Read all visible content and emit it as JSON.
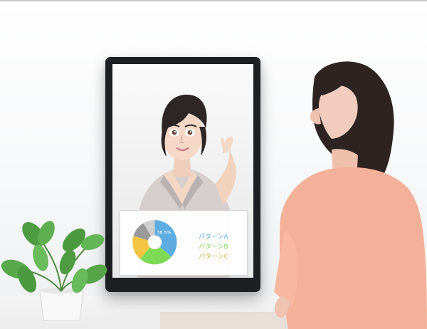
{
  "chart_data": {
    "type": "pie",
    "categories": [
      "パターンA",
      "パターンB",
      "パターンC",
      "",
      ""
    ],
    "values": [
      36.5,
      25,
      18,
      12,
      8.5
    ],
    "labels": [
      "36.5%"
    ],
    "legend": [
      {
        "label": "パターンA",
        "color": "#5dade2"
      },
      {
        "label": "パターンB",
        "color": "#7ed957"
      },
      {
        "label": "パターンC",
        "color": "#f4c542"
      }
    ],
    "colors": {
      "a": "#5dade2",
      "b": "#7ed957",
      "c": "#f4c542",
      "d": "#9a9a9a",
      "e": "#cfcfcf"
    }
  }
}
